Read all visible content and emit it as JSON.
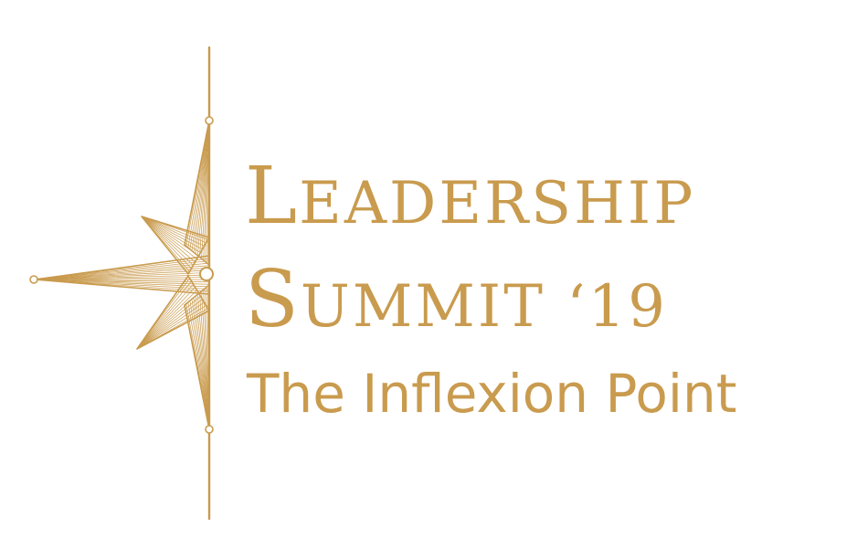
{
  "brand_color": "#C99B4E",
  "logo": {
    "icon": "compass-star-icon",
    "title_line1": {
      "initial": "L",
      "rest": "EADERSHIP"
    },
    "title_line2": {
      "initial": "S",
      "rest": "UMMIT ‘19"
    },
    "tagline": "The Inflexion Point"
  }
}
